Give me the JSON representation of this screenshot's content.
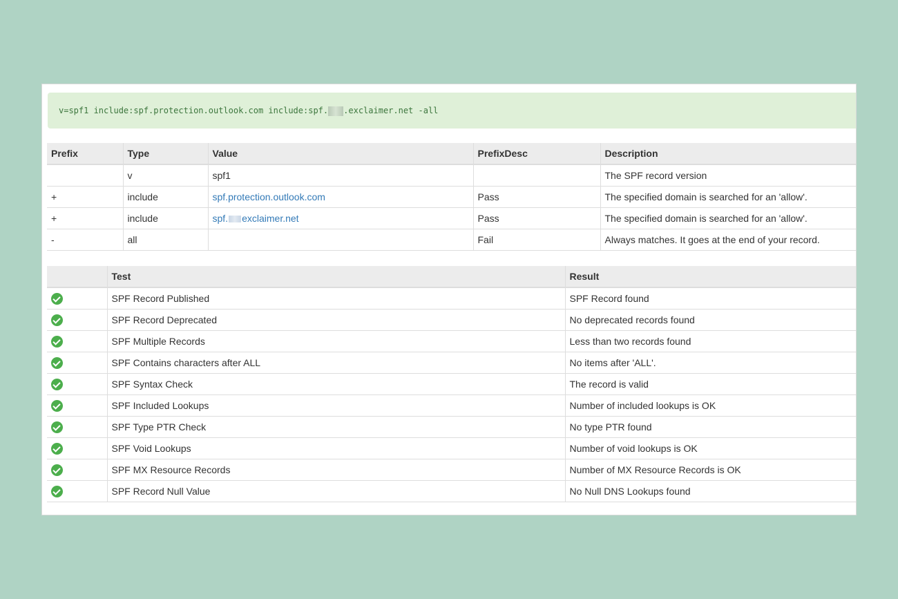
{
  "spf_record": {
    "text_before": "v=spf1 include:spf.protection.outlook.com include:spf.",
    "text_after": ".exclaimer.net -all"
  },
  "record_table": {
    "headers": [
      "Prefix",
      "Type",
      "Value",
      "PrefixDesc",
      "Description"
    ],
    "rows": [
      {
        "prefix": "",
        "type": "v",
        "value": "spf1",
        "value_link": false,
        "prefixdesc": "",
        "description": "The SPF record version"
      },
      {
        "prefix": "+",
        "type": "include",
        "value": "spf.protection.outlook.com",
        "value_link": true,
        "prefixdesc": "Pass",
        "description": "The specified domain is searched for an 'allow'."
      },
      {
        "prefix": "+",
        "type": "include",
        "value_before": "spf.",
        "value_after": "exclaimer.net",
        "value_link": true,
        "prefixdesc": "Pass",
        "description": "The specified domain is searched for an 'allow'."
      },
      {
        "prefix": "-",
        "type": "all",
        "value": "",
        "value_link": false,
        "prefixdesc": "Fail",
        "description": "Always matches. It goes at the end of your record."
      }
    ]
  },
  "test_table": {
    "headers": [
      "",
      "Test",
      "Result"
    ],
    "status_icon": "check-circle-icon",
    "status_color": "#4cae4c",
    "rows": [
      {
        "test": "SPF Record Published",
        "result": "SPF Record found"
      },
      {
        "test": "SPF Record Deprecated",
        "result": "No deprecated records found"
      },
      {
        "test": "SPF Multiple Records",
        "result": "Less than two records found"
      },
      {
        "test": "SPF Contains characters after ALL",
        "result": "No items after 'ALL'."
      },
      {
        "test": "SPF Syntax Check",
        "result": "The record is valid"
      },
      {
        "test": "SPF Included Lookups",
        "result": "Number of included lookups is OK"
      },
      {
        "test": "SPF Type PTR Check",
        "result": "No type PTR found"
      },
      {
        "test": "SPF Void Lookups",
        "result": "Number of void lookups is OK"
      },
      {
        "test": "SPF MX Resource Records",
        "result": "Number of MX Resource Records is OK"
      },
      {
        "test": "SPF Record Null Value",
        "result": "No Null DNS Lookups found"
      }
    ]
  }
}
